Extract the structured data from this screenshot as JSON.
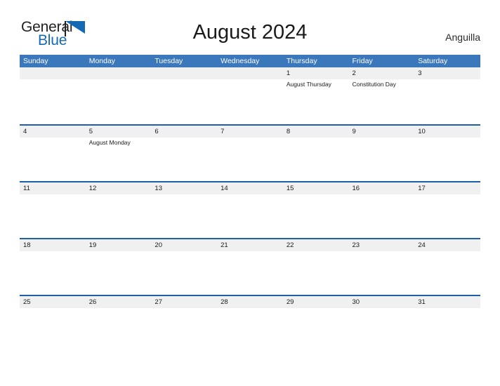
{
  "brand": {
    "line1": "General",
    "line2": "Blue",
    "flag_icon": "blue-flag-triangle",
    "line1_color": "#231f20",
    "line2_color": "#1569b4",
    "flag_color": "#1569b4"
  },
  "header": {
    "title": "August 2024",
    "locale": "Anguilla"
  },
  "theme": {
    "header_blue": "#3a77bb",
    "rule_blue": "#1f5fa8",
    "date_band_gray": "#f0f0f0",
    "text_dark": "#1a1a1a",
    "header_text": "#ffffff"
  },
  "calendar": {
    "weekdays": [
      "Sunday",
      "Monday",
      "Tuesday",
      "Wednesday",
      "Thursday",
      "Friday",
      "Saturday"
    ],
    "weeks": [
      {
        "days": [
          {
            "date": "",
            "events": []
          },
          {
            "date": "",
            "events": []
          },
          {
            "date": "",
            "events": []
          },
          {
            "date": "",
            "events": []
          },
          {
            "date": "1",
            "events": [
              "August Thursday"
            ]
          },
          {
            "date": "2",
            "events": [
              "Constitution Day"
            ]
          },
          {
            "date": "3",
            "events": []
          }
        ]
      },
      {
        "days": [
          {
            "date": "4",
            "events": []
          },
          {
            "date": "5",
            "events": [
              "August Monday"
            ]
          },
          {
            "date": "6",
            "events": []
          },
          {
            "date": "7",
            "events": []
          },
          {
            "date": "8",
            "events": []
          },
          {
            "date": "9",
            "events": []
          },
          {
            "date": "10",
            "events": []
          }
        ]
      },
      {
        "days": [
          {
            "date": "11",
            "events": []
          },
          {
            "date": "12",
            "events": []
          },
          {
            "date": "13",
            "events": []
          },
          {
            "date": "14",
            "events": []
          },
          {
            "date": "15",
            "events": []
          },
          {
            "date": "16",
            "events": []
          },
          {
            "date": "17",
            "events": []
          }
        ]
      },
      {
        "days": [
          {
            "date": "18",
            "events": []
          },
          {
            "date": "19",
            "events": []
          },
          {
            "date": "20",
            "events": []
          },
          {
            "date": "21",
            "events": []
          },
          {
            "date": "22",
            "events": []
          },
          {
            "date": "23",
            "events": []
          },
          {
            "date": "24",
            "events": []
          }
        ]
      },
      {
        "days": [
          {
            "date": "25",
            "events": []
          },
          {
            "date": "26",
            "events": []
          },
          {
            "date": "27",
            "events": []
          },
          {
            "date": "28",
            "events": []
          },
          {
            "date": "29",
            "events": []
          },
          {
            "date": "30",
            "events": []
          },
          {
            "date": "31",
            "events": []
          }
        ]
      }
    ]
  }
}
